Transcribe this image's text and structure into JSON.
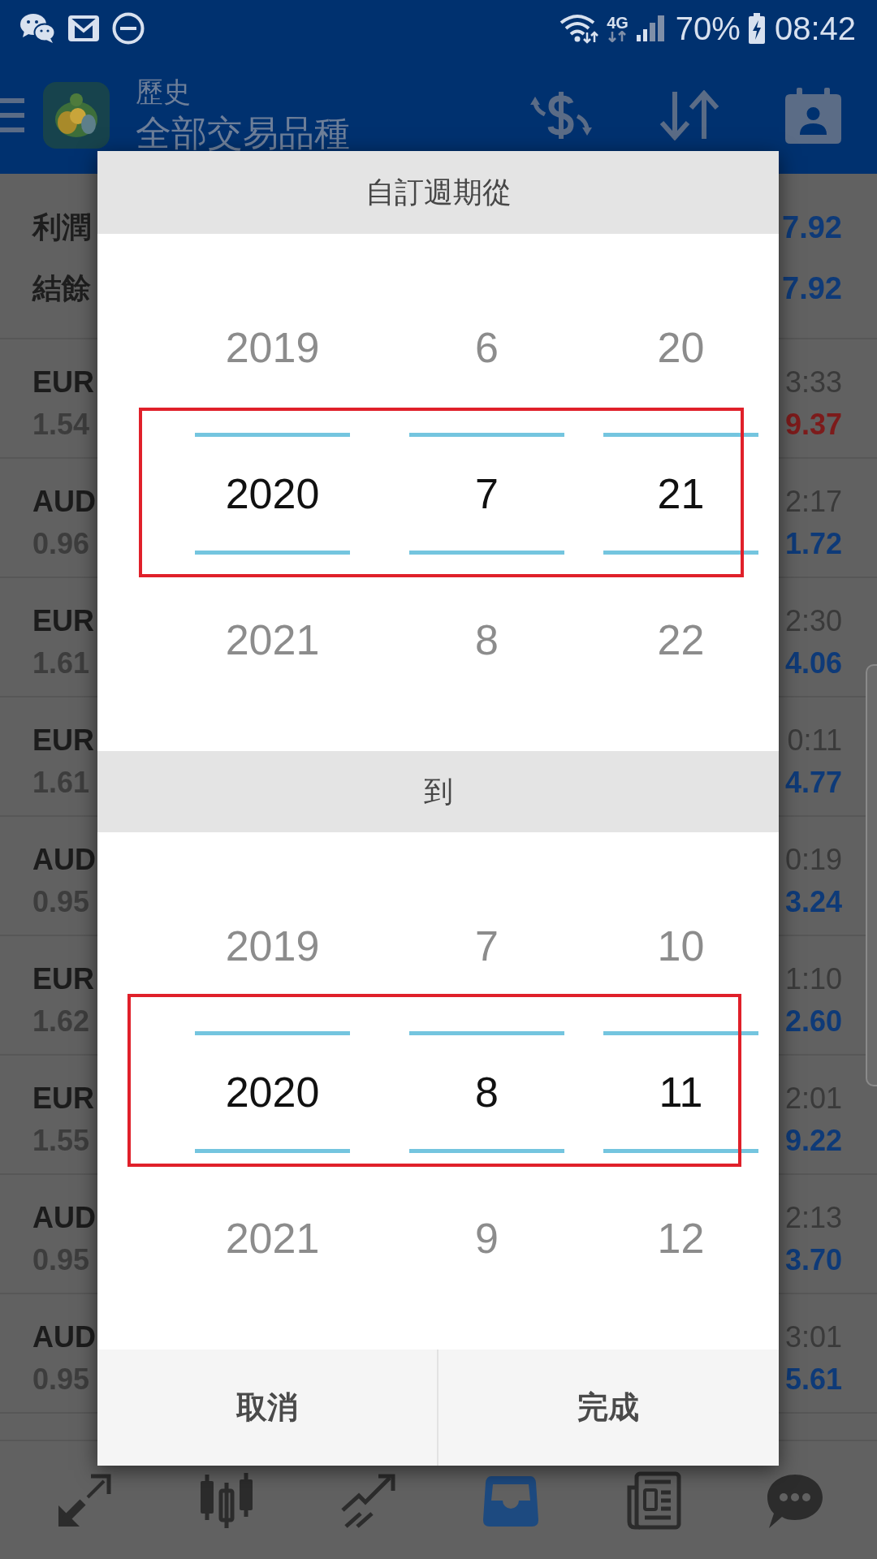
{
  "status_bar": {
    "network_type": "4G",
    "battery": "70%",
    "time": "08:42"
  },
  "app_bar": {
    "title": "歷史",
    "subtitle": "全部交易品種"
  },
  "summary": [
    {
      "label": "利潤",
      "value": "7.92"
    },
    {
      "label": "結餘",
      "value": "7.92"
    }
  ],
  "trades": [
    {
      "symbol": "EUR",
      "price": "1.54",
      "time": "3:33",
      "profit": "9.37",
      "loss": true
    },
    {
      "symbol": "AUD",
      "price": "0.96",
      "time": "2:17",
      "profit": "1.72",
      "loss": false
    },
    {
      "symbol": "EUR",
      "price": "1.61",
      "time": "2:30",
      "profit": "4.06",
      "loss": false
    },
    {
      "symbol": "EUR",
      "price": "1.61",
      "time": "0:11",
      "profit": "4.77",
      "loss": false
    },
    {
      "symbol": "AUD",
      "price": "0.95",
      "time": "0:19",
      "profit": "3.24",
      "loss": false
    },
    {
      "symbol": "EUR",
      "price": "1.62",
      "time": "1:10",
      "profit": "2.60",
      "loss": false
    },
    {
      "symbol": "EUR",
      "price": "1.55",
      "time": "2:01",
      "profit": "9.22",
      "loss": false
    },
    {
      "symbol": "AUD",
      "price": "0.95",
      "time": "2:13",
      "profit": "3.70",
      "loss": false
    },
    {
      "symbol": "AUD",
      "price": "0.95",
      "time": "3:01",
      "profit": "5.61",
      "loss": false
    }
  ],
  "dialog": {
    "sections": [
      {
        "heading": "自訂週期從",
        "picker": {
          "highlighted": true,
          "columns": [
            {
              "above": "2019",
              "value": "2020",
              "below": "2021"
            },
            {
              "above": "6",
              "value": "7",
              "below": "8"
            },
            {
              "above": "20",
              "value": "21",
              "below": "22"
            }
          ]
        }
      },
      {
        "heading": "到",
        "picker": {
          "highlighted": true,
          "columns": [
            {
              "above": "2019",
              "value": "2020",
              "below": "2021"
            },
            {
              "above": "7",
              "value": "8",
              "below": "9"
            },
            {
              "above": "10",
              "value": "11",
              "below": "12"
            }
          ]
        }
      }
    ],
    "buttons": [
      "取消",
      "完成"
    ]
  },
  "bottom_nav": [
    {
      "selected": false
    },
    {
      "selected": false
    },
    {
      "selected": false
    },
    {
      "selected": true
    },
    {
      "selected": false
    },
    {
      "selected": false
    }
  ]
}
